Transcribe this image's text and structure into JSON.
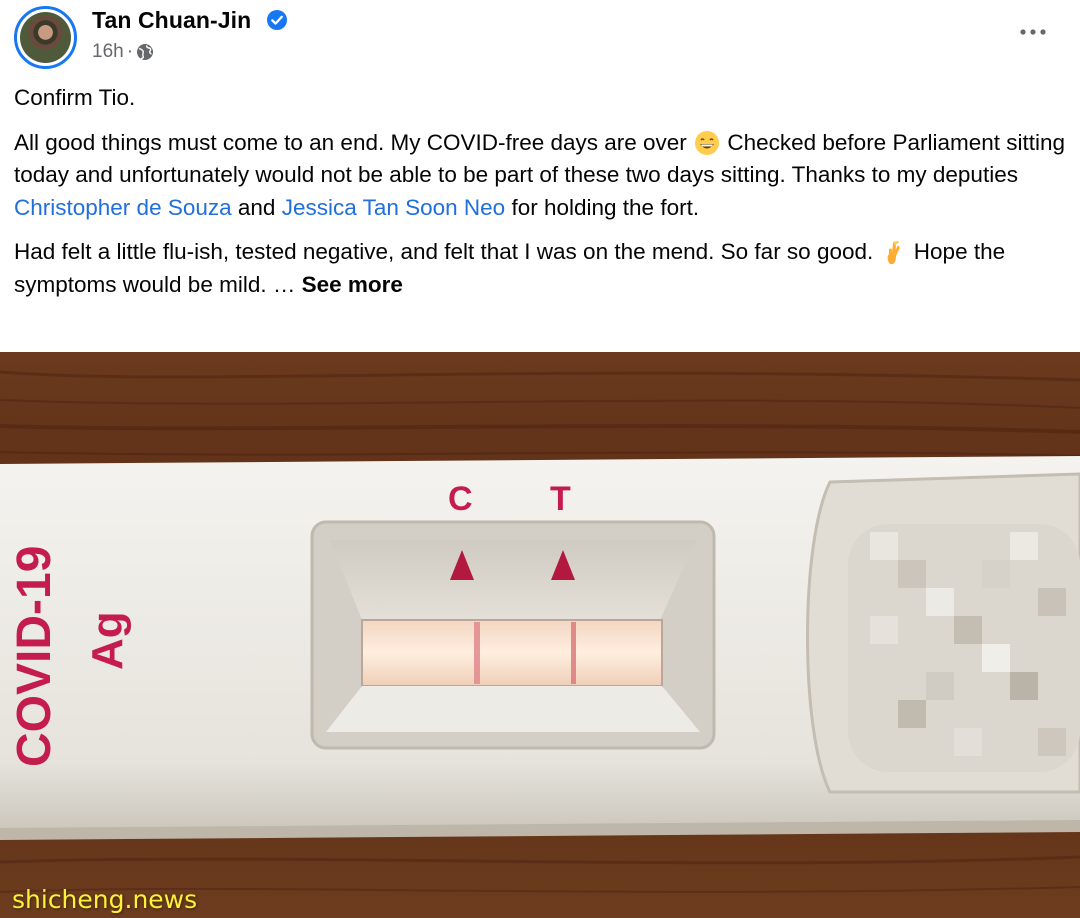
{
  "post": {
    "author": "Tan Chuan-Jin",
    "timestamp": "16h",
    "separator": "·",
    "icons": {
      "verified": "verified-badge-icon",
      "audience": "globe-icon",
      "more": "more-options-icon",
      "grin_emoji": "grinning-face-emoji",
      "crossed_fingers_emoji": "crossed-fingers-emoji"
    },
    "text": {
      "line1": "Confirm Tio.",
      "p2_a": "All good things must come to an end. My COVID-free days are over",
      "p2_b": "Checked before Parliament sitting today and unfortunately would not be able to be part of these two days sitting. Thanks to my deputies",
      "mention1": "Christopher de Souza",
      "p2_c": "and",
      "mention2": "Jessica Tan Soon Neo",
      "p2_d": "for holding the fort.",
      "p3_a": "Had felt a little flu-ish, tested negative, and felt that I was on the mend. So far so good.",
      "p3_b": "Hope the symptoms would be mild. …",
      "see_more": "See more"
    }
  },
  "photo": {
    "kit_label_1": "COVID-19",
    "kit_label_2": "Ag",
    "marker_c": "C",
    "marker_t": "T",
    "watermark": "shicheng.news",
    "colors": {
      "kit_red": "#c41c4e",
      "wood": "#5a2c15",
      "cassette": "#e9e6e0"
    }
  }
}
